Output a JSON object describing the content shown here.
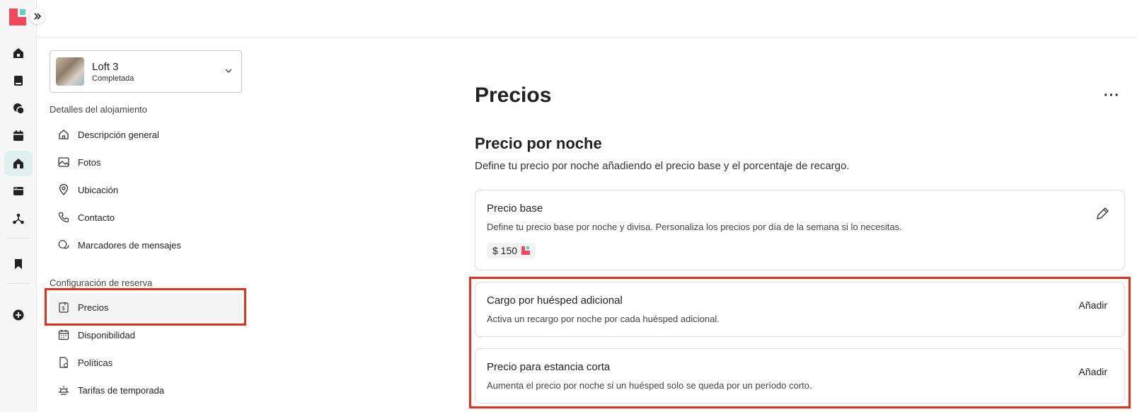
{
  "rail": {
    "icons": [
      "home-icon",
      "book-icon",
      "chat-icon",
      "calendar-icon",
      "house-icon",
      "browser-icon",
      "network-icon",
      "bookmark-icon",
      "plus-circle-icon"
    ]
  },
  "listing": {
    "name": "Loft 3",
    "status": "Completada"
  },
  "nav": {
    "section1": "Detalles del alojamiento",
    "items1": [
      {
        "label": "Descripción general",
        "icon": "home-icon"
      },
      {
        "label": "Fotos",
        "icon": "image-icon"
      },
      {
        "label": "Ubicación",
        "icon": "location-pin-icon"
      },
      {
        "label": "Contacto",
        "icon": "phone-icon"
      },
      {
        "label": "Marcadores de mensajes",
        "icon": "chat-bubbles-icon"
      }
    ],
    "section2": "Configuración de reserva",
    "items2": [
      {
        "label": "Precios",
        "icon": "price-tag-icon"
      },
      {
        "label": "Disponibilidad",
        "icon": "calendar-icon"
      },
      {
        "label": "Políticas",
        "icon": "document-icon"
      },
      {
        "label": "Tarifas de temporada",
        "icon": "sun-icon"
      }
    ]
  },
  "main": {
    "title": "Precios",
    "section_title": "Precio por noche",
    "section_desc": "Define tu precio por noche añadiendo el precio base y el porcentaje de recargo.",
    "cards": [
      {
        "title": "Precio base",
        "desc": "Define tu precio base por noche y divisa. Personaliza los precios por día de la semana si lo necesitas.",
        "price": "$ 150"
      },
      {
        "title": "Cargo por huésped adicional",
        "desc": "Activa un recargo por noche por cada huésped adicional.",
        "action": "Añadir"
      },
      {
        "title": "Precio para estancia corta",
        "desc": "Aumenta el precio por noche si un huésped solo se queda por un período corto.",
        "action": "Añadir"
      }
    ]
  },
  "colors": {
    "brand": "#f0485c",
    "brand_accent": "#5ed3c0",
    "highlight": "#e4311b",
    "active_rail": "#dff1ee"
  }
}
